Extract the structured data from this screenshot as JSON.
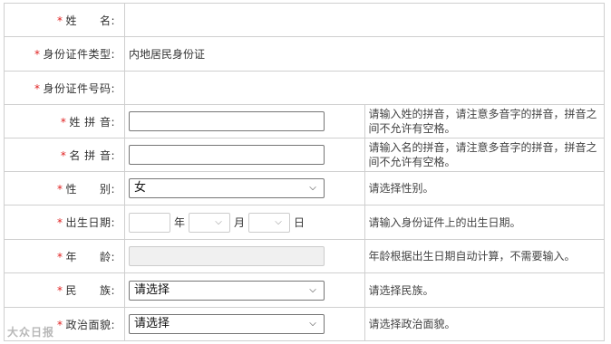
{
  "form": {
    "surname_name": {
      "label": "姓　　名:",
      "value": ""
    },
    "id_type": {
      "label": "身份证件类型:",
      "value": "内地居民身份证"
    },
    "id_number": {
      "label": "身份证件号码:",
      "value": ""
    },
    "surname_pinyin": {
      "label": "姓 拼 音:",
      "value": "",
      "hint": "请输入姓的拼音，请注意多音字的拼音，拼音之间不允许有空格。"
    },
    "given_pinyin": {
      "label": "名 拼 音:",
      "value": "",
      "hint": "请输入名的拼音，请注意多音字的拼音，拼音之间不允许有空格。"
    },
    "gender": {
      "label": "性　　别:",
      "selected": "女",
      "hint": "请选择性别。"
    },
    "birthdate": {
      "label": "出生日期:",
      "year_unit": "年",
      "month_unit": "月",
      "day_unit": "日",
      "hint": "请输入身份证件上的出生日期。"
    },
    "age": {
      "label": "年　　龄:",
      "hint": "年龄根据出生日期自动计算，不需要输入。"
    },
    "ethnicity": {
      "label": "民　　族:",
      "selected": "请选择",
      "hint": "请选择民族。"
    },
    "political_status": {
      "label": "政治面貌:",
      "selected": "请选择",
      "hint": "请选择政治面貌。"
    },
    "required_mark": "*"
  },
  "watermark": "大众日报",
  "icons": {
    "dropdown": "chevron-down-icon"
  }
}
